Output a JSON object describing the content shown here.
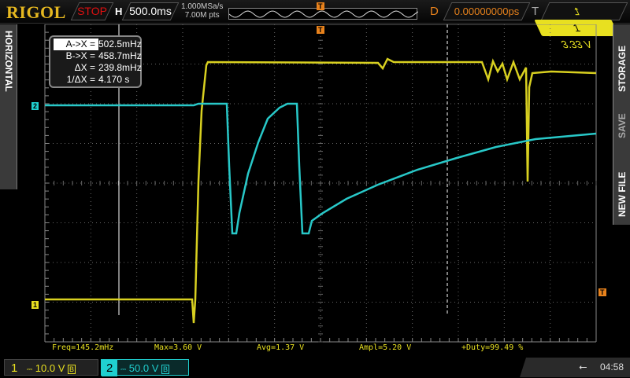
{
  "header": {
    "brand": "RIGOL",
    "run_status": "STOP",
    "horizontal_label": "H",
    "timebase": "500.0ms",
    "sample_rate": "1.000MSa/s",
    "memory_depth": "7.00M pts",
    "delay_label": "D",
    "delay": "0.00000000ps",
    "trigger_label": "T",
    "trigger_source": "1",
    "trigger_level": "3.33 V"
  },
  "left_panel": {
    "label": "HORIZONTAL"
  },
  "right_panel": {
    "items": [
      "STORAGE",
      "SAVE",
      "NEW FILE"
    ]
  },
  "cursor_readout": [
    {
      "key": "A->X =",
      "value": "502.5mHz"
    },
    {
      "key": "B->X =",
      "value": "458.7mHz"
    },
    {
      "key": "ΔX =",
      "value": "239.8mHz"
    },
    {
      "key": "1/ΔX =",
      "value": "4.170 s"
    }
  ],
  "measurements": [
    "Freq=145.2mHz",
    "Max=3.60 V",
    "Avg=1.37 V",
    "Ampl=5.20 V",
    "+Duty=99.49 %"
  ],
  "channels": [
    {
      "num": "1",
      "scale": "10.0 V",
      "color": "#e8e020"
    },
    {
      "num": "2",
      "scale": "50.0 V",
      "color": "#20d0d0"
    }
  ],
  "markers": {
    "trigger": "T",
    "ch1": "1",
    "ch2": "2"
  },
  "status": {
    "time": "04:58"
  }
}
